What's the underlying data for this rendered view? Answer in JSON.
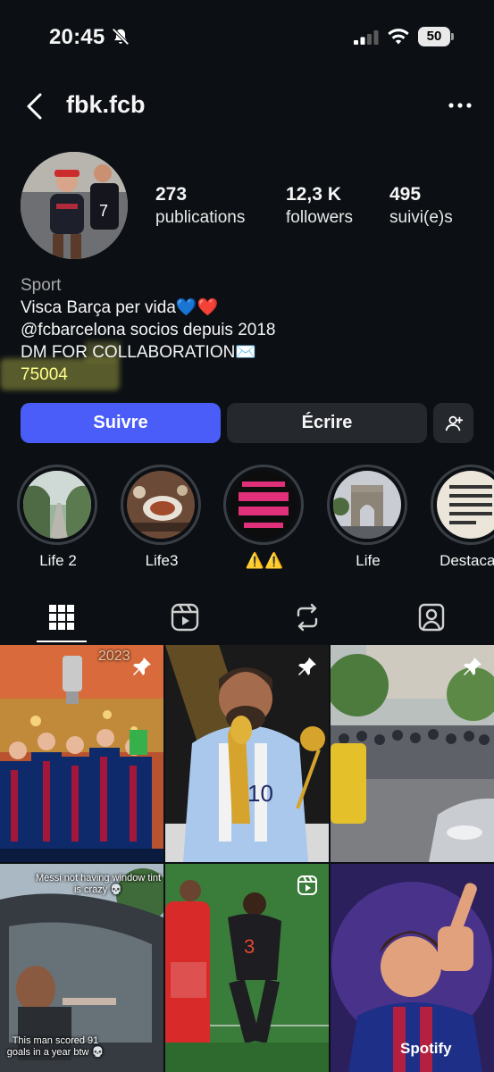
{
  "status_bar": {
    "time": "20:45",
    "battery": "50"
  },
  "header": {
    "username": "fbk.fcb"
  },
  "stats": [
    {
      "value": "273",
      "label": "publications"
    },
    {
      "value": "12,3 K",
      "label": "followers"
    },
    {
      "value": "495",
      "label": "suivi(e)s"
    }
  ],
  "bio": {
    "category": "Sport",
    "line1": "Visca Barça per vida💙❤️",
    "line2": "@fcbarcelona socios depuis 2018",
    "line3": "DM FOR COLLABORATION✉️",
    "line4": "75004"
  },
  "buttons": {
    "follow": "Suivre",
    "message": "Écrire"
  },
  "highlights": [
    {
      "label": "Life 2"
    },
    {
      "label": "Life3"
    },
    {
      "label": "⚠️⚠️"
    },
    {
      "label": "Life"
    },
    {
      "label": "Destacad"
    }
  ],
  "posts": [
    {
      "overlay": "pin",
      "text": "2023"
    },
    {
      "overlay": "pin",
      "text": ""
    },
    {
      "overlay": "pin",
      "text": ""
    },
    {
      "overlay": "none",
      "text": "Messi not having window tint is crazy 💀",
      "text2": "This man scored 91 goals in a year btw 💀"
    },
    {
      "overlay": "reel",
      "text": ""
    },
    {
      "overlay": "none",
      "text": "Spotify"
    }
  ],
  "colors": {
    "accent": "#4a5df9",
    "background": "#0c1014",
    "button_secondary": "#25292e"
  }
}
